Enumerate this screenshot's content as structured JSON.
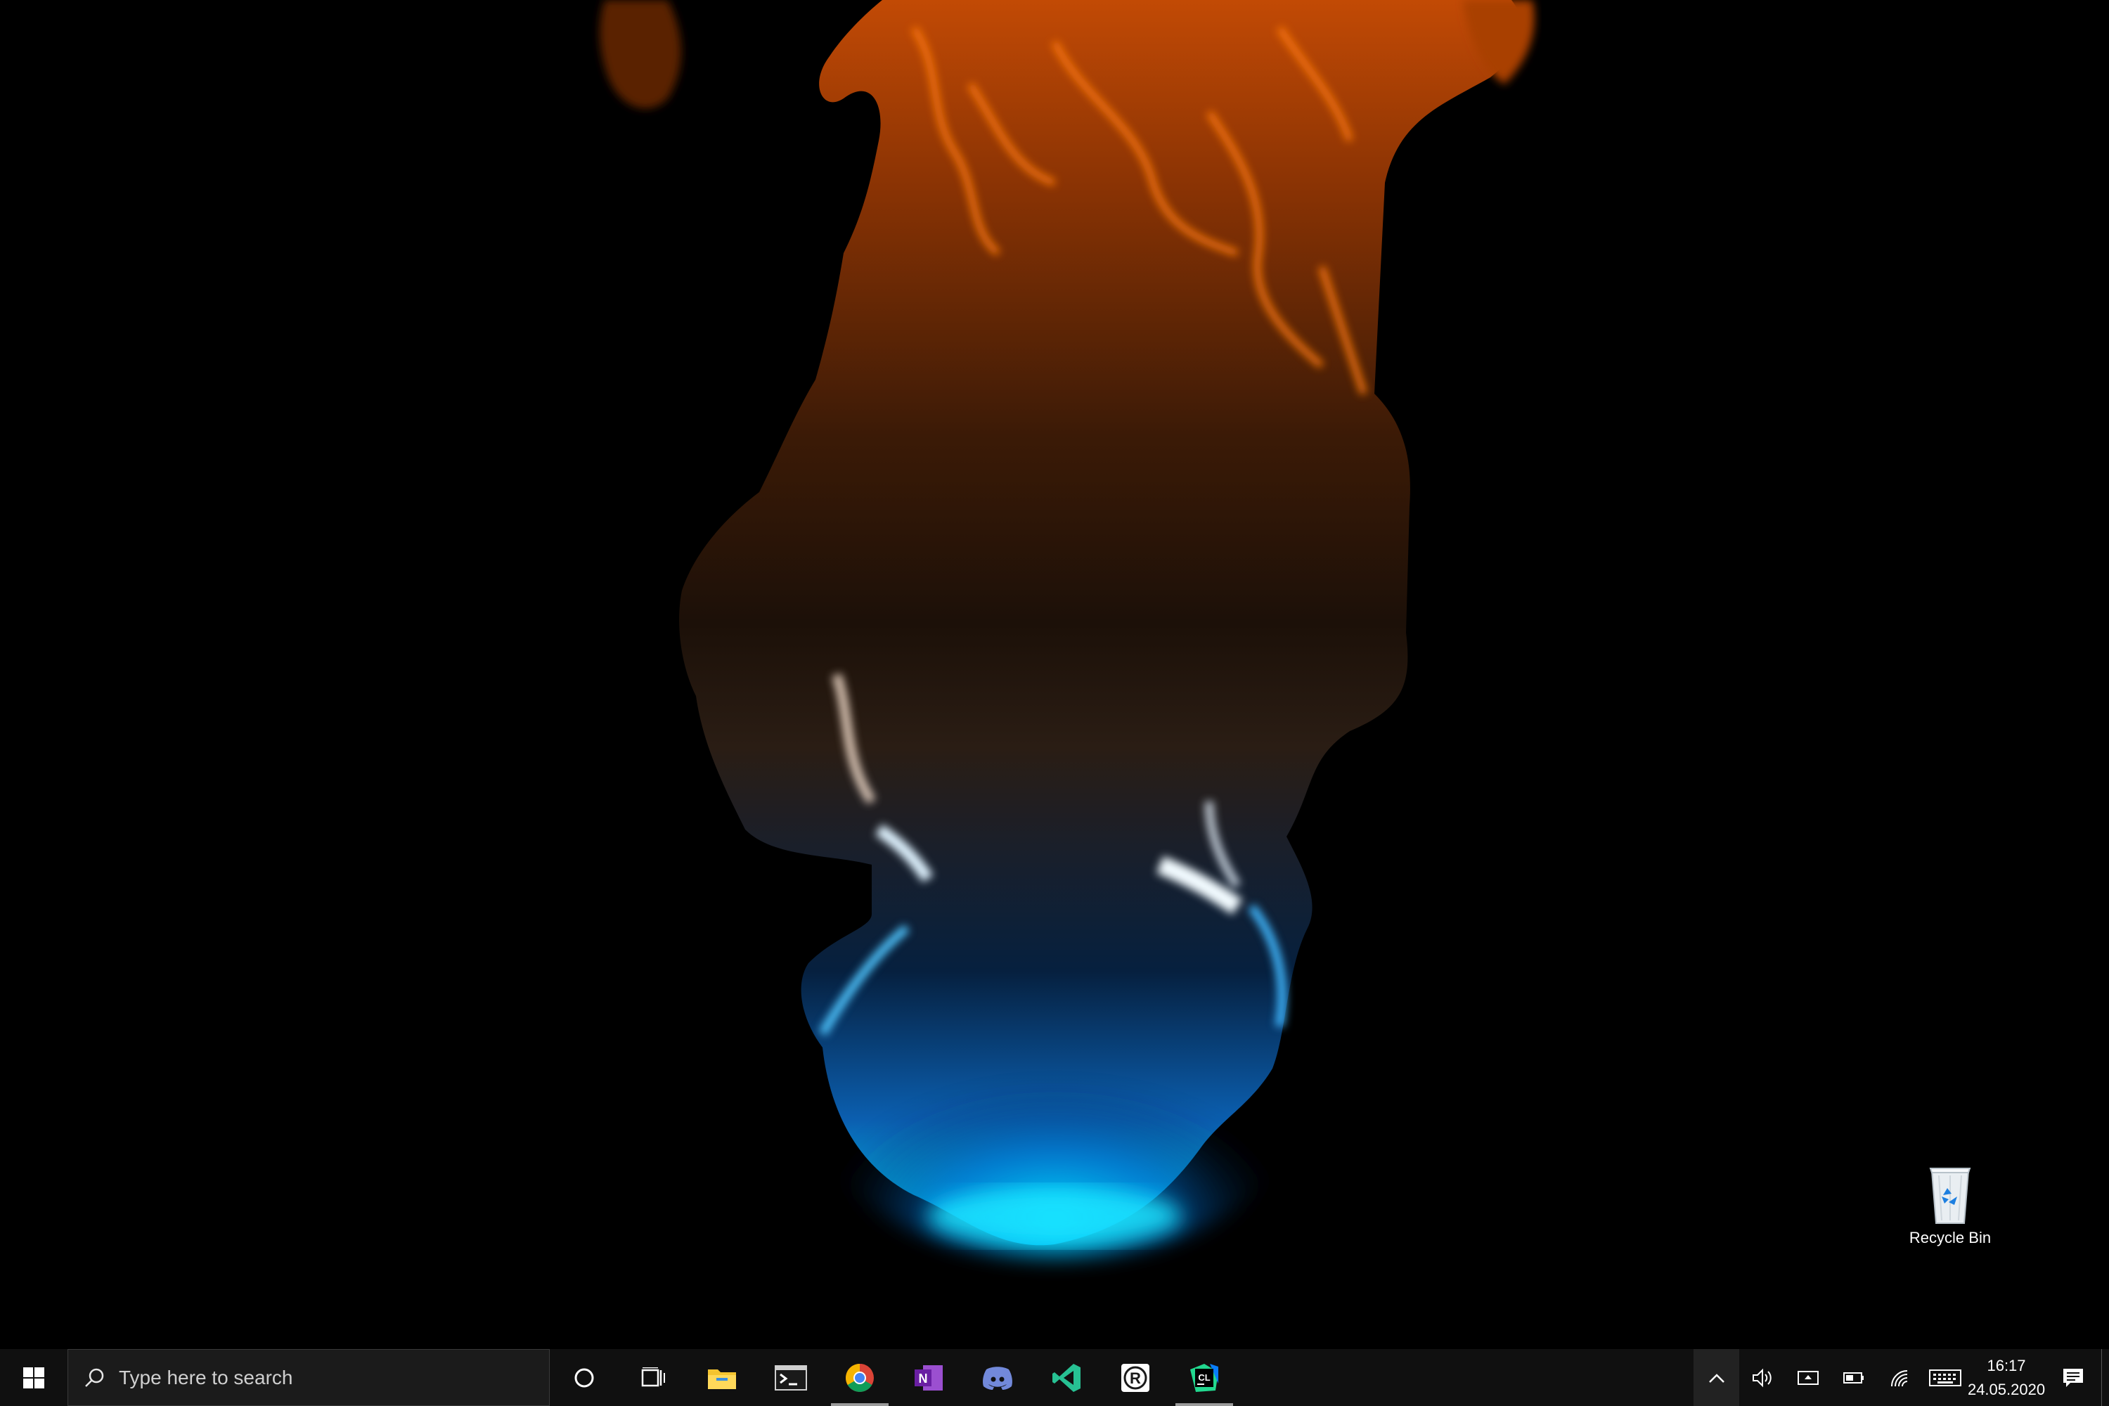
{
  "desktop": {
    "icons": [
      {
        "label": "Recycle Bin",
        "icon": "recycle-bin-icon"
      }
    ]
  },
  "taskbar": {
    "start_icon": "windows-logo-icon",
    "search": {
      "placeholder": "Type here to search",
      "icon": "search-icon"
    },
    "cortana_icon": "cortana-circle-icon",
    "task_view_icon": "task-view-icon",
    "apps": [
      {
        "name": "File Explorer",
        "icon": "folder-icon",
        "active": false
      },
      {
        "name": "Terminal",
        "icon": "terminal-icon",
        "active": false
      },
      {
        "name": "Google Chrome",
        "icon": "chrome-icon",
        "active": true
      },
      {
        "name": "OneNote",
        "icon": "onenote-icon",
        "badge": "N",
        "active": false
      },
      {
        "name": "Discord",
        "icon": "discord-icon",
        "active": false
      },
      {
        "name": "Visual Studio Code",
        "icon": "vscode-icon",
        "active": false
      },
      {
        "name": "RStudio",
        "icon": "rstudio-icon",
        "badge": "R",
        "active": false
      },
      {
        "name": "CLion",
        "icon": "clion-icon",
        "badge": "CL",
        "active": true
      }
    ],
    "tray": {
      "icons": [
        "chevron-up-icon",
        "volume-icon",
        "display-icon",
        "battery-icon",
        "wifi-icon",
        "keyboard-icon"
      ],
      "time": "16:17",
      "date": "24.05.2020",
      "notification_icon": "notification-icon"
    }
  },
  "colors": {
    "taskbar_bg": "#101010",
    "flame_orange": "#ff6a00",
    "flame_blue": "#00c8ff"
  }
}
